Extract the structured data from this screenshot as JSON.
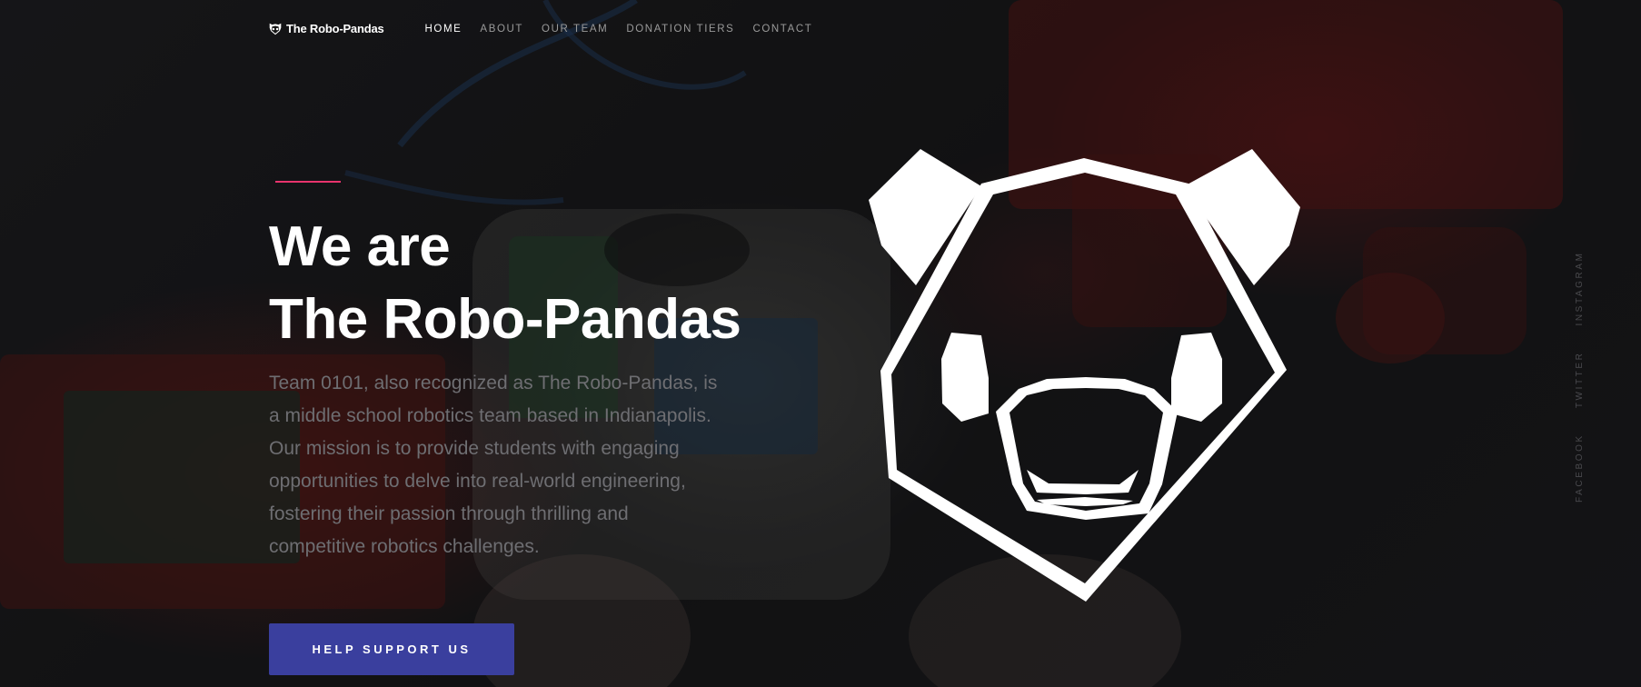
{
  "nav": {
    "brand": "The Robo-Pandas",
    "brand_icon": "panda-logo-icon",
    "items": [
      {
        "label": "HOME",
        "active": true
      },
      {
        "label": "ABOUT",
        "active": false
      },
      {
        "label": "OUR TEAM",
        "active": false
      },
      {
        "label": "DONATION TIERS",
        "active": false
      },
      {
        "label": "CONTACT",
        "active": false
      }
    ]
  },
  "hero": {
    "title_line1": "We are",
    "title_line2": "The Robo-Pandas",
    "description": "Team 0101, also recognized as The Robo-Pandas, is a middle school robotics team based in Indianapolis. Our mission is to provide students with engaging opportunities to delve into real-world engineering, fostering their passion through thrilling and competitive robotics challenges.",
    "cta_label": "HELP SUPPORT US",
    "graphic": "panda-head-icon"
  },
  "social": {
    "items": [
      "FACEBOOK",
      "TWITTER",
      "INSTAGRAM"
    ]
  },
  "colors": {
    "accent": "#e8336d",
    "button": "#3a3f9e",
    "text_primary": "#ffffff",
    "text_muted": "#6e6e72"
  }
}
